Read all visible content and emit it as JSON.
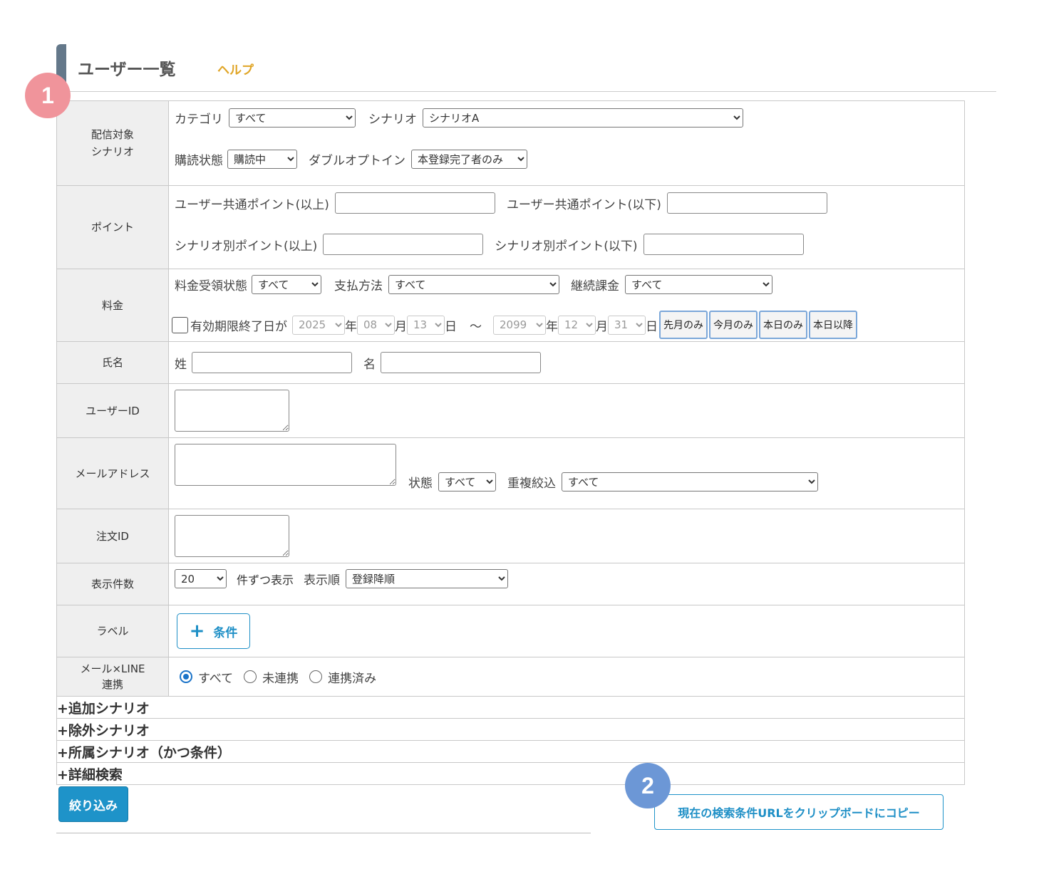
{
  "header": {
    "title": "ユーザー一覧",
    "help": "ヘルプ"
  },
  "markers": [
    "1",
    "2"
  ],
  "rows": {
    "scenario": {
      "label_l1": "配信対象",
      "label_l2": "シナリオ",
      "category_label": "カテゴリ",
      "category_value": "すべて",
      "scenario_label": "シナリオ",
      "scenario_value": "シナリオA",
      "subscription_label": "購読状態",
      "subscription_value": "購読中",
      "double_optin_label": "ダブルオプトイン",
      "double_optin_value": "本登録完了者のみ"
    },
    "point": {
      "label": "ポイント",
      "common_min": "ユーザー共通ポイント(以上)",
      "common_max": "ユーザー共通ポイント(以下)",
      "scenario_min": "シナリオ別ポイント(以上)",
      "scenario_max": "シナリオ別ポイント(以下)"
    },
    "fee": {
      "label": "料金",
      "receipt_label": "料金受領状態",
      "receipt_value": "すべて",
      "payment_label": "支払方法",
      "payment_value": "すべて",
      "recurring_label": "継続課金",
      "recurring_value": "すべて",
      "expiry_label": "有効期限終了日が",
      "from_year": "2025",
      "from_month": "08",
      "from_day": "13",
      "to_year": "2099",
      "to_month": "12",
      "to_day": "31",
      "year": "年",
      "month": "月",
      "day": "日",
      "tilde": "～",
      "quick": [
        "先月のみ",
        "今月のみ",
        "本日のみ",
        "本日以降"
      ]
    },
    "name": {
      "label": "氏名",
      "last": "姓",
      "first": "名"
    },
    "userid": {
      "label": "ユーザーID"
    },
    "email": {
      "label": "メールアドレス",
      "status_label": "状態",
      "status_value": "すべて",
      "dedupe_label": "重複絞込",
      "dedupe_value": "すべて"
    },
    "order": {
      "label": "注文ID"
    },
    "display": {
      "label": "表示件数",
      "count_value": "20",
      "count_suffix": "件ずつ表示",
      "order_label": "表示順",
      "order_value": "登録降順"
    },
    "tag": {
      "label": "ラベル",
      "button": "条件"
    },
    "link": {
      "label_l1": "メール×LINE",
      "label_l2": "連携",
      "options": [
        "すべて",
        "未連携",
        "連携済み"
      ],
      "selected": "すべて"
    }
  },
  "expanders": [
    "+追加シナリオ",
    "+除外シナリオ",
    "+所属シナリオ（かつ条件）",
    "+詳細検索"
  ],
  "actions": {
    "filter": "絞り込み",
    "copy_url": "現在の検索条件URLをクリップボードにコピー"
  }
}
